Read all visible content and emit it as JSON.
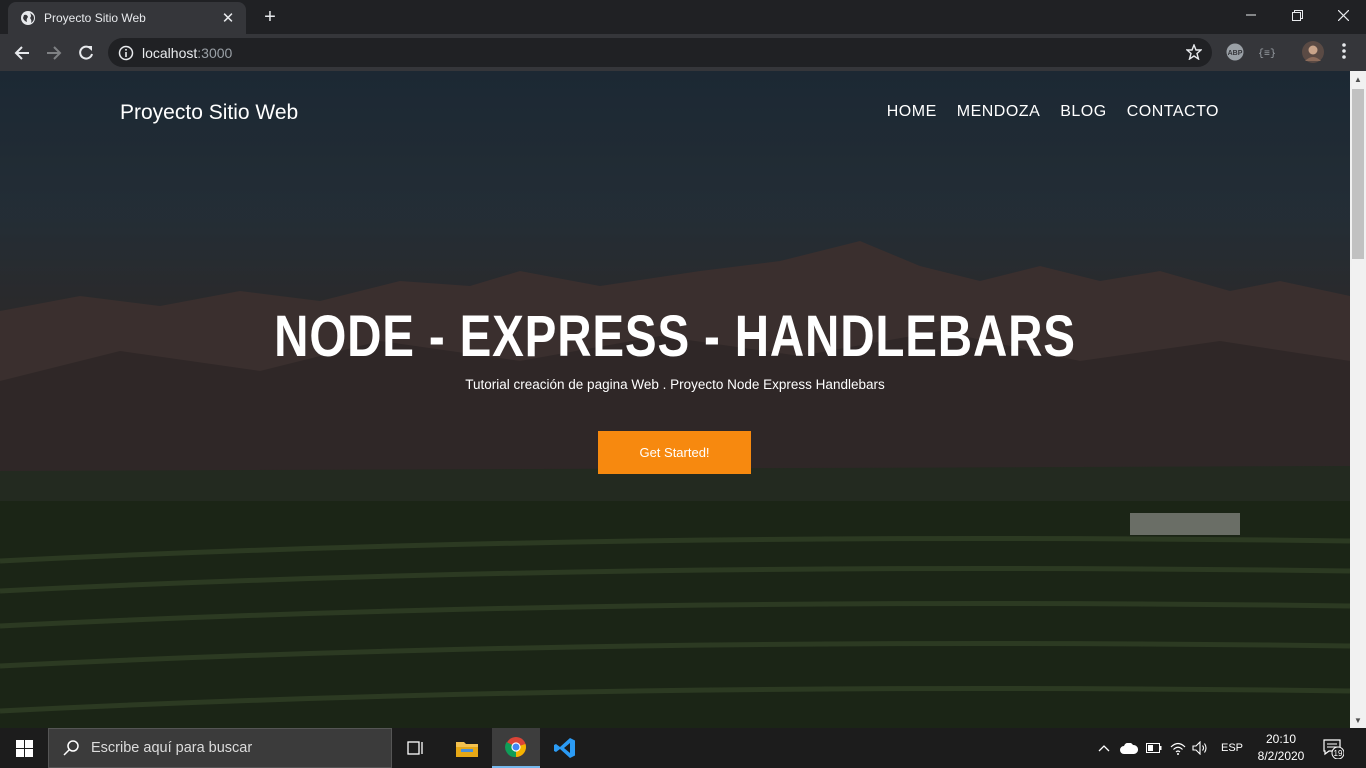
{
  "browser": {
    "tab_title": "Proyecto Sitio Web",
    "tab_close": "✕",
    "new_tab": "+",
    "url_host": "localhost",
    "url_port": ":3000",
    "extensions": [
      "ABP",
      "{≡}"
    ]
  },
  "site": {
    "brand": "Proyecto Sitio Web",
    "nav": [
      "HOME",
      "MENDOZA",
      "BLOG",
      "CONTACTO"
    ],
    "hero_title": "NODE - EXPRESS - HANDLEBARS",
    "hero_subtitle": "Tutorial creación de pagina Web . Proyecto Node Express Handlebars",
    "cta_label": "Get Started!",
    "accent_color": "#f7890f"
  },
  "taskbar": {
    "search_placeholder": "Escribe aquí para buscar",
    "language": "ESP",
    "time": "20:10",
    "date": "8/2/2020",
    "notification_count": "19",
    "pinned_apps": [
      "task-view",
      "file-explorer",
      "chrome",
      "vscode"
    ]
  }
}
